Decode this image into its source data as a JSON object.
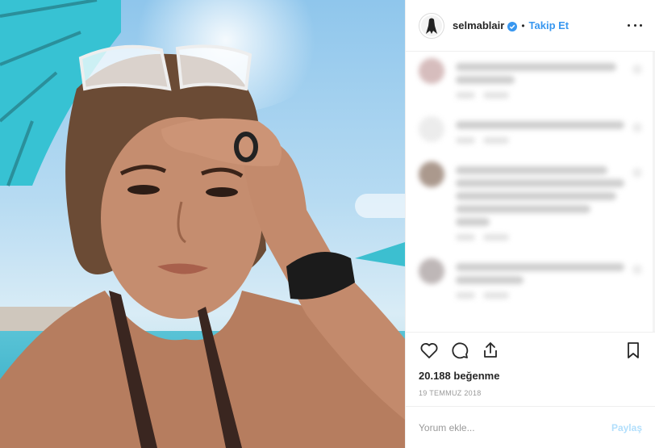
{
  "post": {
    "username": "selmablair",
    "separator": "•",
    "follow_label": "Takip Et",
    "likes_text": "20.188 beğenme",
    "date_text": "19 TEMMUZ 2018"
  },
  "comment_box": {
    "placeholder": "Yorum ekle...",
    "submit_label": "Paylaş"
  },
  "icons": {
    "verified": "verified-badge-icon",
    "more": "more-options-icon",
    "like": "heart-icon",
    "comment": "comment-bubble-icon",
    "share": "share-icon",
    "save": "bookmark-icon"
  },
  "colors": {
    "accent": "#3897f0",
    "text": "#262626",
    "muted": "#999999",
    "border": "#efefef",
    "submit_disabled": "#b2dffc"
  }
}
